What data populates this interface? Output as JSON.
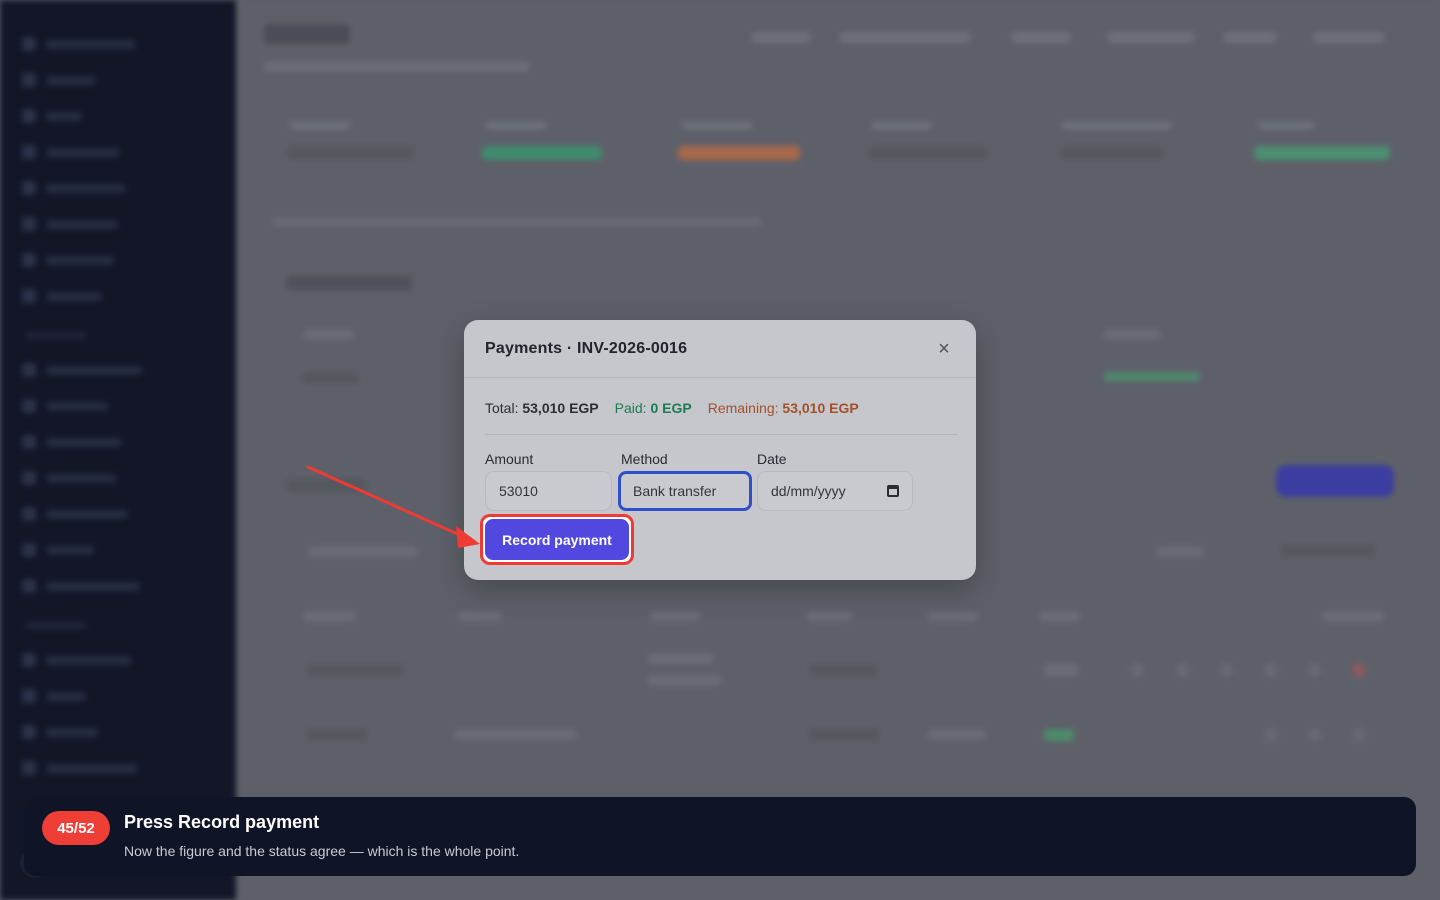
{
  "modal": {
    "title": "Payments · INV-2026-0016",
    "close_icon": "close-icon",
    "summary": {
      "total_label": "Total:",
      "total_value": "53,010 EGP",
      "paid_label": "Paid:",
      "paid_value": "0 EGP",
      "remaining_label": "Remaining:",
      "remaining_value": "53,010 EGP"
    },
    "form": {
      "amount_label": "Amount",
      "amount_value": "53010",
      "method_label": "Method",
      "method_value": "Bank transfer",
      "date_label": "Date",
      "date_placeholder": "dd/mm/yyyy",
      "date_icon": "calendar-icon"
    },
    "record_label": "Record payment"
  },
  "tour": {
    "step": "45/52",
    "title": "Press Record payment",
    "description": "Now the figure and the status agree — which is the whole point."
  },
  "colors": {
    "accent": "#5248e0",
    "highlight": "#ef3b33",
    "paid": "#1d7a55",
    "remaining": "#a3502a",
    "sidebar": "#121627"
  }
}
